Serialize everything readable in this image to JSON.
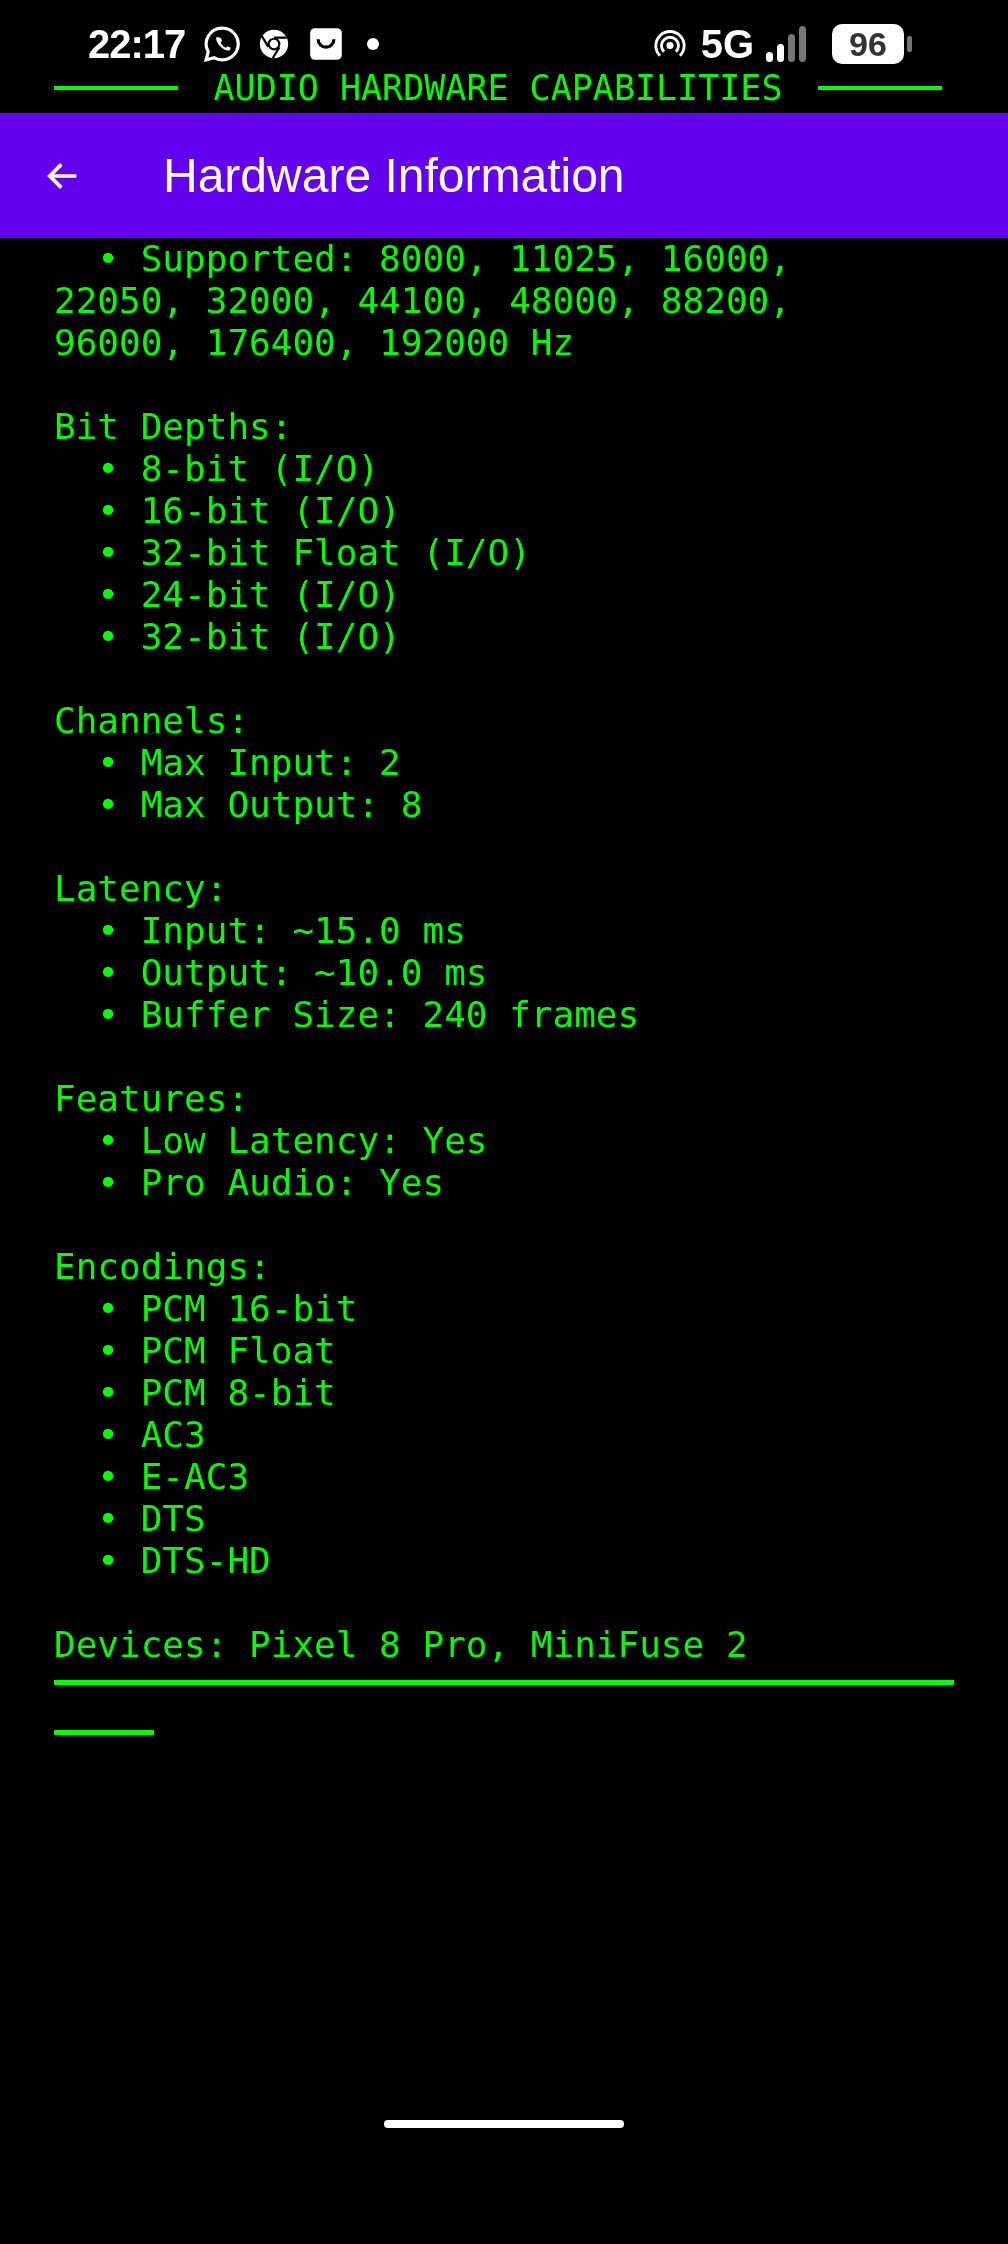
{
  "status_bar": {
    "time": "22:17",
    "network": "5G",
    "battery": "96"
  },
  "banner": {
    "title": "AUDIO HARDWARE CAPABILITIES"
  },
  "app_bar": {
    "title": "Hardware Information"
  },
  "sections": [
    {
      "items": [
        "• Supported: 8000, 11025, 16000, 22050, 32000, 44100, 48000, 88200, 96000, 176400, 192000 Hz"
      ]
    },
    {
      "heading": "Bit Depths:",
      "items": [
        "• 8-bit (I/O)",
        "• 16-bit (I/O)",
        "• 32-bit Float (I/O)",
        "• 24-bit (I/O)",
        "• 32-bit (I/O)"
      ]
    },
    {
      "heading": "Channels:",
      "items": [
        "• Max Input: 2",
        "• Max Output: 8"
      ]
    },
    {
      "heading": "Latency:",
      "items": [
        "• Input: ~15.0 ms",
        "• Output: ~10.0 ms",
        "• Buffer Size: 240 frames"
      ]
    },
    {
      "heading": "Features:",
      "items": [
        "• Low Latency: Yes",
        "• Pro Audio: Yes"
      ]
    },
    {
      "heading": "Encodings:",
      "items": [
        "• PCM 16-bit",
        "• PCM Float",
        "• PCM 8-bit",
        "• AC3",
        "• E-AC3",
        "• DTS",
        "• DTS-HD"
      ]
    },
    {
      "heading": "Devices: Pixel 8 Pro, MiniFuse 2"
    }
  ]
}
